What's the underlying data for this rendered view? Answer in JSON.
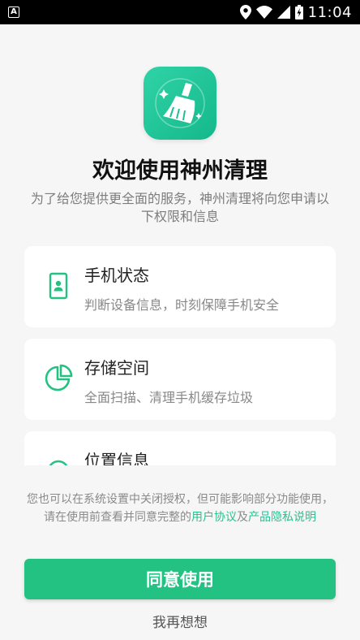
{
  "status_bar": {
    "left_icon": "A",
    "time": "11:04",
    "icons": [
      "location-icon",
      "wifi-icon",
      "signal-icon",
      "battery-charging-icon"
    ]
  },
  "app": {
    "icon": "broom-cleaner-icon",
    "title": "欢迎使用神州清理",
    "subtitle": "为了给您提供更全面的服务，神州清理将向您申请以下权限和信息"
  },
  "permissions": [
    {
      "title": "手机状态",
      "desc": "判断设备信息，时刻保障手机安全",
      "icon": "phone-badge-icon"
    },
    {
      "title": "存储空间",
      "desc": "全面扫描、清理手机缓存垃圾",
      "icon": "pie-chart-icon"
    },
    {
      "title": "位置信息",
      "desc": "",
      "icon": "location-pin-icon"
    }
  ],
  "notice": {
    "text_before": "您也可以在系统设置中关闭授权，但可能影响部分功能使用，请在使用前查看并同意完整的",
    "user_agreement": "用户协议",
    "conjunction": "及",
    "privacy_policy": "产品隐私说明"
  },
  "buttons": {
    "agree": "同意使用",
    "think": "我再想想"
  },
  "colors": {
    "accent": "#23c283",
    "link": "#26c392",
    "background": "#f6f6f6"
  }
}
